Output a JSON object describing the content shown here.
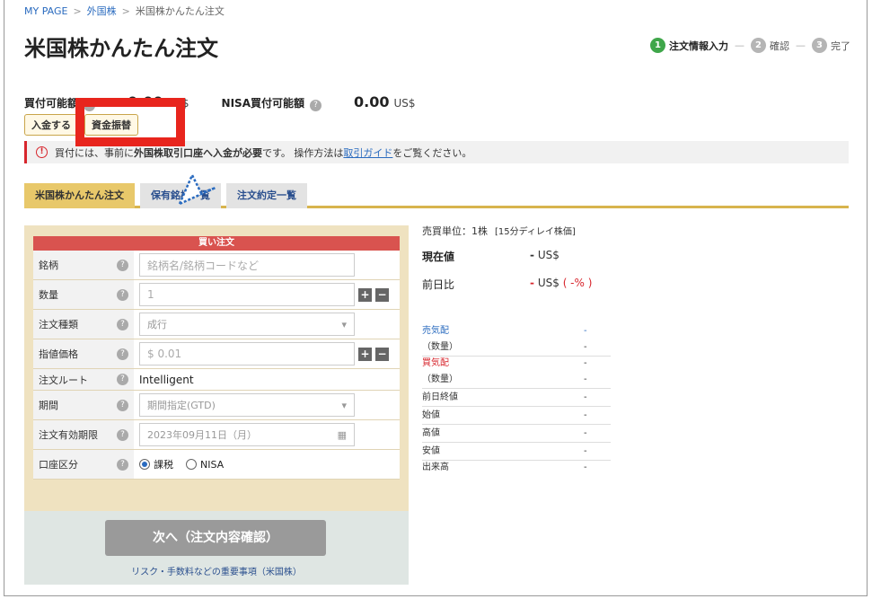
{
  "breadcrumb": {
    "items": [
      "MY PAGE",
      "外国株",
      "米国株かんたん注文"
    ]
  },
  "page": {
    "title": "米国株かんたん注文"
  },
  "steps": [
    {
      "num": "1",
      "label": "注文情報入力"
    },
    {
      "num": "2",
      "label": "確認"
    },
    {
      "num": "3",
      "label": "完了"
    }
  ],
  "balance": {
    "buy_label": "買付可能額",
    "buy_amount": "0.00",
    "nisa_label": "NISA買付可能額",
    "nisa_amount": "0.00",
    "unit": "US$"
  },
  "buttons": {
    "deposit": "入金する",
    "transfer": "資金振替"
  },
  "notice": {
    "t1": "買付には、事前に",
    "b1": "外国株取引口座へ入金が必要",
    "t2": "です。 操作方法は",
    "link": "取引ガイド",
    "t3": "をご覧ください。"
  },
  "tabs": [
    "米国株かんたん注文",
    "保有銘柄一覧",
    "注文約定一覧"
  ],
  "order": {
    "header": "買い注文",
    "rows": {
      "symbol": {
        "label": "銘柄",
        "placeholder": "銘柄名/銘柄コードなど"
      },
      "quantity": {
        "label": "数量",
        "value": "1"
      },
      "order_type": {
        "label": "注文種類",
        "value": "成行"
      },
      "limit_price": {
        "label": "指値価格",
        "value": "$ 0.01"
      },
      "route": {
        "label": "注文ルート",
        "value": "Intelligent"
      },
      "period": {
        "label": "期間",
        "value": "期間指定(GTD)"
      },
      "expiry": {
        "label": "注文有効期限",
        "value": "2023年09月11日（月）"
      },
      "account": {
        "label": "口座区分",
        "opt1": "課税",
        "opt2": "NISA"
      }
    },
    "next_button": "次へ（注文内容確認）",
    "risk_link": "リスク・手数料などの重要事項（米国株）"
  },
  "quote": {
    "unit_text": "売買単位：1株",
    "delay_text": "[15分ディレイ株価]",
    "current_label": "現在値",
    "change_label": "前日比",
    "dash": "-",
    "unit": "US$",
    "pct": "( -% )"
  },
  "board": [
    {
      "label": "売気配",
      "value": "-",
      "color": "blue"
    },
    {
      "label": "（数量）",
      "value": "-",
      "color": ""
    },
    {
      "label": "買気配",
      "value": "-",
      "color": "red"
    },
    {
      "label": "（数量）",
      "value": "-",
      "color": ""
    },
    {
      "label": "前日終値",
      "value": "-",
      "color": ""
    },
    {
      "label": "始値",
      "value": "-",
      "color": ""
    },
    {
      "label": "高値",
      "value": "-",
      "color": ""
    },
    {
      "label": "安値",
      "value": "-",
      "color": ""
    },
    {
      "label": "出来高",
      "value": "-",
      "color": ""
    }
  ]
}
